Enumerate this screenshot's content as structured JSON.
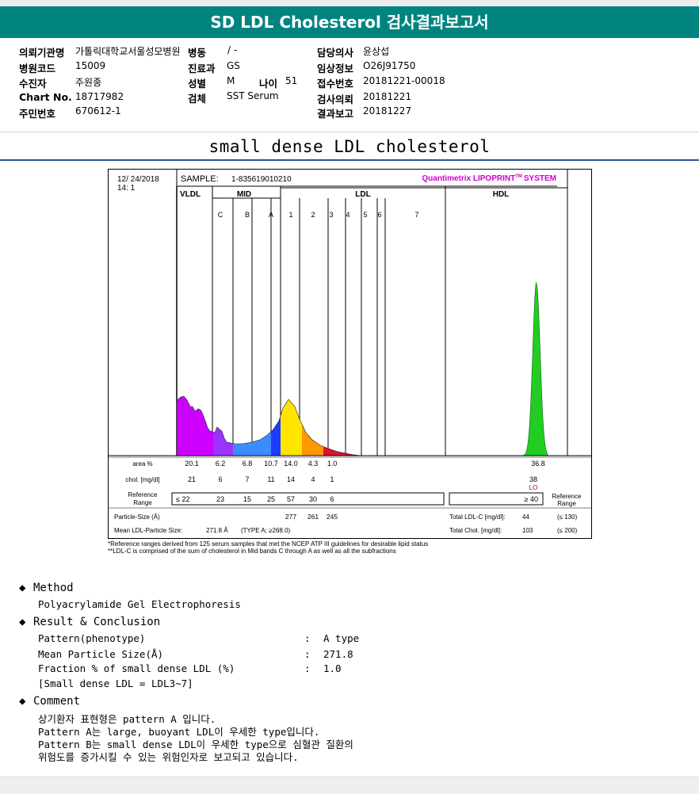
{
  "header": {
    "title": "SD LDL Cholesterol 검사결과보고서"
  },
  "info": {
    "requester": {
      "label": "의뢰기관명",
      "value": "가톨릭대학교서울성모병원"
    },
    "ward": {
      "label": "병동",
      "value": "/ -"
    },
    "doctor": {
      "label": "담당의사",
      "value": "윤상섭"
    },
    "hospital_code": {
      "label": "병원코드",
      "value": "15009"
    },
    "department": {
      "label": "진료과",
      "value": "GS"
    },
    "clinical_info": {
      "label": "임상정보",
      "value": "O26J91750"
    },
    "examinee": {
      "label": "수진자",
      "value": "주원종"
    },
    "sex": {
      "label": "성별",
      "value": "M"
    },
    "age": {
      "label": "나이",
      "value": "51"
    },
    "receipt_no": {
      "label": "접수번호",
      "value": "20181221-00018"
    },
    "chart_no": {
      "label": "Chart No.",
      "value": "18717982"
    },
    "specimen": {
      "label": "검체",
      "value": "SST Serum"
    },
    "request_date": {
      "label": "검사의뢰",
      "value": "20181221"
    },
    "resident_no": {
      "label": "주민번호",
      "value": "670612-1"
    },
    "report_date": {
      "label": "결과보고",
      "value": "20181227"
    }
  },
  "subtitle": "small dense LDL cholesterol",
  "report": {
    "date": "12/ 24/2018",
    "time": "14: 1",
    "sample_label": "SAMPLE:",
    "sample_id": "1-835619010210",
    "system": "Quantimetrix LIPOPRINT",
    "system_tm": "TM",
    "system_suffix": "SYSTEM",
    "groups": {
      "vldl": "VLDL",
      "mid": "MID",
      "ldl": "LDL",
      "hdl": "HDL"
    },
    "bands": [
      "C",
      "B",
      "A",
      "1",
      "2",
      "3",
      "4",
      "5",
      "6",
      "7"
    ],
    "rows": {
      "area_label": "area %",
      "area": [
        "20.1",
        "6.2",
        "6.8",
        "10.7",
        "14.0",
        "4.3",
        "1.0"
      ],
      "hdl_area": "36.8",
      "chol_label": "chol. [mg/dl]",
      "chol": [
        "21",
        "6",
        "7",
        "11",
        "14",
        "4",
        "1"
      ],
      "hdl_chol": "38",
      "hdl_flag": "LO",
      "ref_label_1": "Reference",
      "ref_label_2": "Range",
      "ref_first": "≤ 22",
      "ref": [
        "23",
        "15",
        "25",
        "57",
        "30",
        "6"
      ],
      "hdl_ref": "≥ 40",
      "ref_right_1": "Reference",
      "ref_right_2": "Range",
      "size_label": "Particle-Size (Å)",
      "sizes": [
        "277",
        "261",
        "245"
      ],
      "mean_label": "Mean LDL-Particle Size:",
      "mean_value": "271.8 Å",
      "mean_type": "(TYPE A; ≥268.0)",
      "total_ldl_label": "Total LDL-C [mg/dl]:",
      "total_ldl": "44",
      "total_ldl_ref": "(≤ 130)",
      "total_chol_label": "Total Chol. [mg/dl]:",
      "total_chol": "103",
      "total_chol_ref": "(≤ 200)"
    }
  },
  "chart_data": {
    "type": "area",
    "title": "",
    "xlabel": "",
    "ylabel": "",
    "fractions": [
      "VLDL",
      "MID C",
      "MID B",
      "MID A",
      "LDL 1",
      "LDL 2",
      "LDL 3",
      "LDL 4",
      "LDL 5",
      "LDL 6",
      "LDL 7",
      "HDL"
    ],
    "colors": [
      "#cc00ff",
      "#9b33ff",
      "#3d8cff",
      "#1a3dff",
      "#ffe400",
      "#ff9900",
      "#e01030",
      "#cc0033",
      "#cc0033",
      "#cc0033",
      "#cc0033",
      "#22cc22"
    ],
    "area_pct": [
      20.1,
      6.2,
      6.8,
      10.7,
      14.0,
      4.3,
      1.0,
      null,
      null,
      null,
      null,
      36.8
    ],
    "chol_mg_dl": [
      21,
      6,
      7,
      11,
      14,
      4,
      1,
      null,
      null,
      null,
      null,
      38
    ]
  },
  "footnotes": [
    "*Reference ranges derived from 125 serum samples that met the NCEP ATP III guidelines for desirable lipid status",
    "**LDL-C is comprised of the sum of cholesterol in Mid bands C through A as well as all the subfractions"
  ],
  "method": {
    "heading": "Method",
    "text": "Polyacrylamide Gel Electrophoresis"
  },
  "result": {
    "heading": "Result & Conclusion",
    "pattern_label": "Pattern(phenotype)",
    "pattern_value": "A type",
    "size_label": "Mean Particle Size(Å)",
    "size_value": "271.8",
    "fraction_label": "Fraction % of small dense LDL (%)",
    "fraction_value": "1.0",
    "note": "[Small dense LDL = LDL3~7]",
    "colon": ":"
  },
  "comment": {
    "heading": "Comment",
    "lines": [
      "상기환자 표현형은 pattern A 입니다.",
      "Pattern A는 large, buoyant LDL이 우세한 type입니다.",
      "Pattern B는 small dense LDL이 우세한 type으로 심혈관 질환의",
      "위험도를 증가시킬 수 있는 위험인자로 보고되고 있습니다."
    ]
  },
  "icons": {
    "bullet": "diamond-bullet-icon"
  },
  "theme": {
    "header_bg": "#008480",
    "accent_line": "#2f5597",
    "system_color": "#cc00cc",
    "flag_color": "#cc0000"
  }
}
